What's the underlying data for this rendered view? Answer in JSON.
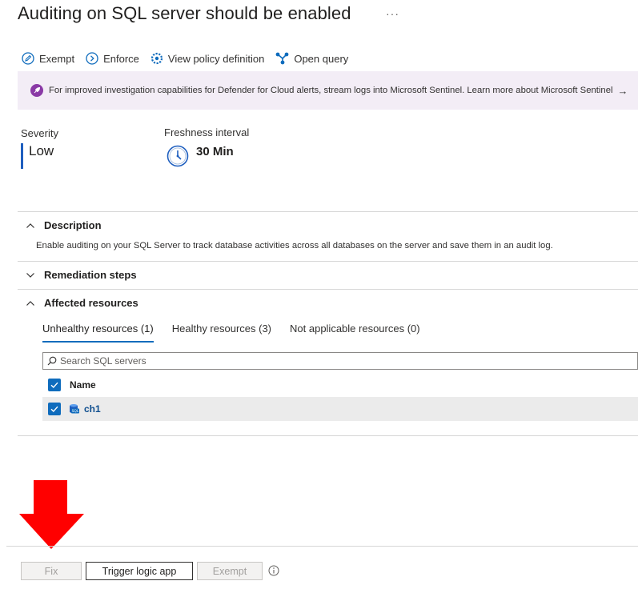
{
  "header": {
    "title": "Auditing on SQL server should be enabled",
    "more": "···"
  },
  "toolbar": {
    "exempt": "Exempt",
    "enforce": "Enforce",
    "view_policy": "View policy definition",
    "open_query": "Open query"
  },
  "banner": {
    "text": "For improved investigation capabilities for Defender for Cloud alerts, stream logs into Microsoft Sentinel. Learn more about Microsoft Sentinel",
    "arrow": "→"
  },
  "severity": {
    "label": "Severity",
    "value": "Low"
  },
  "freshness": {
    "label": "Freshness interval",
    "value": "30 Min"
  },
  "description": {
    "title": "Description",
    "text": "Enable auditing on your SQL Server to track database activities across all databases on the server and save them in an audit log."
  },
  "remediation": {
    "title": "Remediation steps"
  },
  "affected": {
    "title": "Affected resources",
    "tabs": [
      "Unhealthy resources (1)",
      "Healthy resources (3)",
      "Not applicable resources (0)"
    ],
    "search_placeholder": "Search SQL servers",
    "column_name": "Name",
    "rows": [
      {
        "name": "ch1"
      }
    ]
  },
  "footer": {
    "fix": "Fix",
    "trigger": "Trigger logic app",
    "exempt": "Exempt"
  },
  "colors": {
    "accent": "#0f6cbd",
    "severity_bar": "#1f5fbf",
    "banner_bg": "#f3edf6",
    "arrow": "#ff0000"
  }
}
